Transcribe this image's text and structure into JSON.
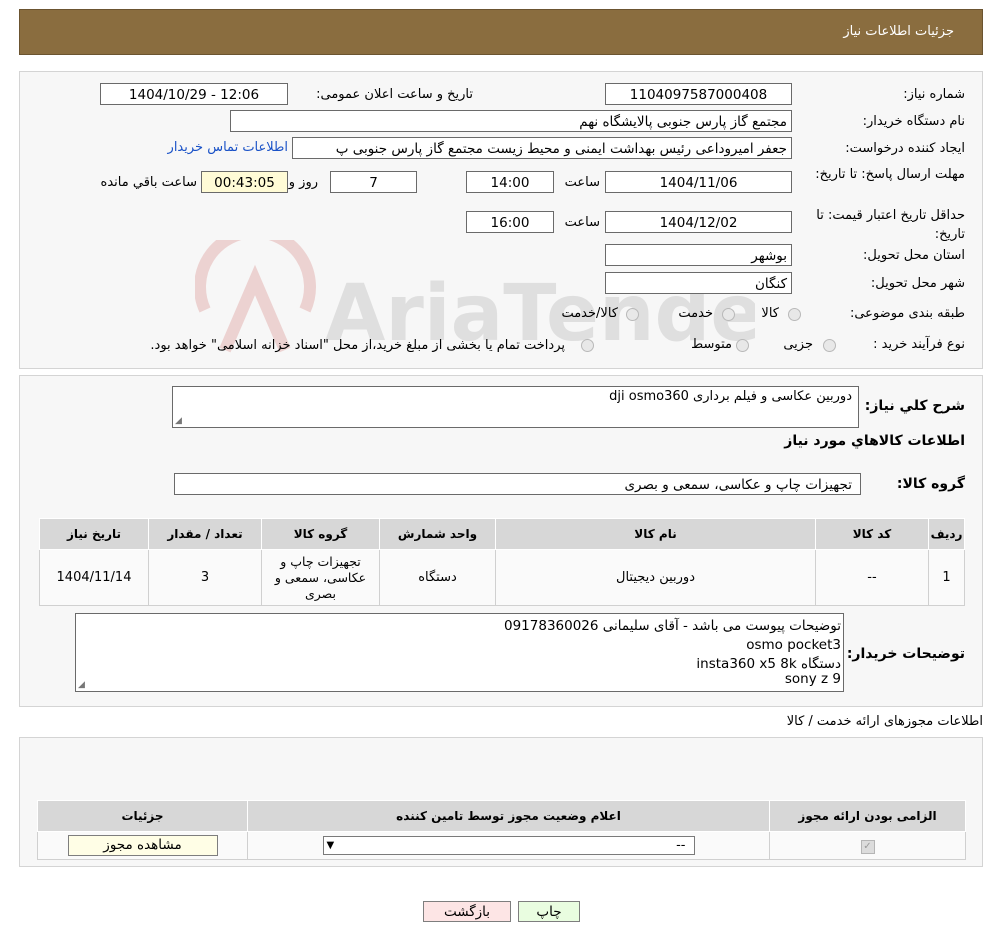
{
  "header": {
    "title": "جزئیات اطلاعات نیاز"
  },
  "form": {
    "need_number_label": "شماره نیاز:",
    "need_number": "1104097587000408",
    "announce_label": "تاریخ و ساعت اعلان عمومی:",
    "announce_value": "1404/10/29 - 12:06",
    "buyer_org_label": "نام دستگاه خریدار:",
    "buyer_org": "مجتمع گاز پارس جنوبی  پالایشگاه نهم",
    "creator_label": "ایجاد کننده درخواست:",
    "creator": "جعفر امیروداعی رئیس بهداشت ایمنی و محیط زیست مجتمع گاز پارس جنوبی  پ",
    "contact_link": "اطلاعات تماس خریدار",
    "reply_deadline_label": "مهلت ارسال پاسخ: تا تاریخ:",
    "reply_date": "1404/11/06",
    "time_label": "ساعت",
    "reply_time": "14:00",
    "days": "7",
    "days_label": "روز و",
    "remaining": "00:43:05",
    "remaining_label": "ساعت باقي مانده",
    "validity_label": "حداقل تاریخ اعتبار قیمت: تا تاریخ:",
    "validity_date": "1404/12/02",
    "validity_time": "16:00",
    "province_label": "استان محل تحویل:",
    "province": "بوشهر",
    "city_label": "شهر محل تحویل:",
    "city": "کنگان",
    "category_label": "طبقه بندی موضوعی:",
    "category_options": [
      "کالا",
      "خدمت",
      "کالا/خدمت"
    ],
    "process_label": "نوع فرآیند خرید :",
    "process_options": [
      "جزیی",
      "متوسط"
    ],
    "process_note": "پرداخت تمام یا بخشی از مبلغ خرید،از محل \"اسناد خزانه اسلامی\" خواهد بود."
  },
  "watermark": {
    "text": "AriaTender.neT"
  },
  "summary": {
    "description_label": "شرح کلي نياز:",
    "description": "دوربین عکاسی و فیلم برداری dji osmo360",
    "goods_info_title": "اطلاعات کالاهاي مورد نياز",
    "goods_group_label": "گروه کالا:",
    "goods_group": "تجهیزات چاپ و عکاسی، سمعی و بصری"
  },
  "goods_table": {
    "headers": [
      "ردیف",
      "کد کالا",
      "نام کالا",
      "واحد شمارش",
      "گروه کالا",
      "تعداد / مقدار",
      "تاریخ نیاز"
    ],
    "rows": [
      [
        "1",
        "--",
        "دوربین دیجیتال",
        "دستگاه",
        "تجهیزات چاپ و عکاسی، سمعی و بصری",
        "3",
        "1404/11/14"
      ]
    ]
  },
  "buyer_notes": {
    "label": "توضیحات خریدار:",
    "lines": [
      "توضیحات پیوست می باشد - آقای سلیمانی 09178360026",
      "osmo pocket3",
      "دستگاه insta360 x5 8k",
      "sony z 9"
    ]
  },
  "permits": {
    "title": "اطلاعات مجوزهای ارائه خدمت / کالا",
    "headers": [
      "الزامی بودن ارائه مجوز",
      "اعلام وضعیت مجوز توسط تامین کننده",
      "جزئیات"
    ],
    "select_value": "--",
    "view_button": "مشاهده مجوز"
  },
  "actions": {
    "print": "چاپ",
    "back": "بازگشت"
  }
}
